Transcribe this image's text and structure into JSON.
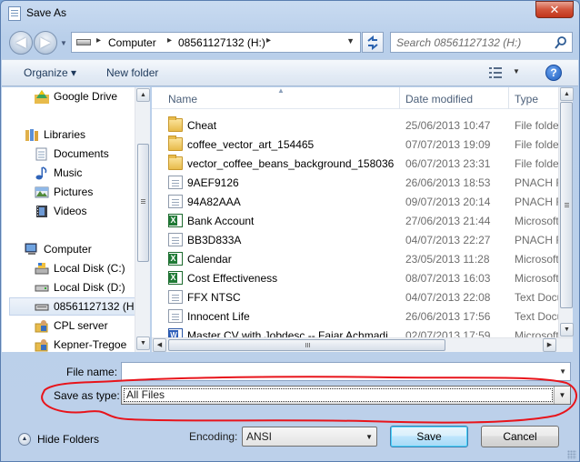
{
  "window": {
    "title": "Save As",
    "close_label": "✕"
  },
  "navigation": {
    "back_glyph": "◀",
    "forward_glyph": "▶",
    "breadcrumbs": [
      "Computer",
      "08561127132 (H:)"
    ],
    "search_placeholder": "Search 08561127132 (H:)"
  },
  "toolbar": {
    "organize_label": "Organize ▾",
    "new_folder_label": "New folder",
    "help_label": "?"
  },
  "nav_pane": {
    "items": [
      {
        "label": "Google Drive",
        "icon": "google-drive-icon"
      },
      {
        "label": "Libraries",
        "icon": "libraries-icon"
      },
      {
        "label": "Documents",
        "icon": "documents-icon"
      },
      {
        "label": "Music",
        "icon": "music-icon"
      },
      {
        "label": "Pictures",
        "icon": "pictures-icon"
      },
      {
        "label": "Videos",
        "icon": "videos-icon"
      },
      {
        "label": "Computer",
        "icon": "computer-icon"
      },
      {
        "label": "Local Disk (C:)",
        "icon": "local-disk-icon"
      },
      {
        "label": "Local Disk (D:)",
        "icon": "removable-disk-icon"
      },
      {
        "label": "08561127132 (H:)",
        "icon": "usb-drive-icon"
      },
      {
        "label": "CPL server",
        "icon": "network-user-icon"
      },
      {
        "label": "Kepner-Tregoe",
        "icon": "network-user-icon"
      }
    ]
  },
  "file_list": {
    "columns": [
      "Name",
      "Date modified",
      "Type"
    ],
    "rows": [
      {
        "name": "Cheat",
        "date": "25/06/2013 10:47",
        "type": "File folder",
        "icon": "folder-icon"
      },
      {
        "name": "coffee_vector_art_154465",
        "date": "07/07/2013 19:09",
        "type": "File folder",
        "icon": "folder-icon"
      },
      {
        "name": "vector_coffee_beans_background_158036",
        "date": "06/07/2013 23:31",
        "type": "File folder",
        "icon": "folder-icon"
      },
      {
        "name": "9AEF9126",
        "date": "26/06/2013 18:53",
        "type": "PNACH File",
        "icon": "document-icon"
      },
      {
        "name": "94A82AAA",
        "date": "09/07/2013 20:14",
        "type": "PNACH File",
        "icon": "document-icon"
      },
      {
        "name": "Bank Account",
        "date": "27/06/2013 21:44",
        "type": "Microsoft",
        "icon": "excel-icon"
      },
      {
        "name": "BB3D833A",
        "date": "04/07/2013 22:27",
        "type": "PNACH File",
        "icon": "document-icon"
      },
      {
        "name": "Calendar",
        "date": "23/05/2013 11:28",
        "type": "Microsoft",
        "icon": "excel-icon"
      },
      {
        "name": "Cost Effectiveness",
        "date": "08/07/2013 16:03",
        "type": "Microsoft",
        "icon": "excel-icon"
      },
      {
        "name": "FFX NTSC",
        "date": "04/07/2013 22:08",
        "type": "Text Document",
        "icon": "document-icon"
      },
      {
        "name": "Innocent Life",
        "date": "26/06/2013 17:56",
        "type": "Text Document",
        "icon": "document-icon"
      },
      {
        "name": "Master CV with Jobdesc -- Fajar Achmadi",
        "date": "02/07/2013 17:59",
        "type": "Microsoft",
        "icon": "word-icon"
      }
    ]
  },
  "form": {
    "file_name_label": "File name:",
    "file_name_value": "",
    "save_as_type_label": "Save as type:",
    "save_as_type_value": "All Files",
    "encoding_label": "Encoding:",
    "encoding_value": "ANSI"
  },
  "footer": {
    "hide_folders_label": "Hide Folders",
    "save_label": "Save",
    "cancel_label": "Cancel"
  },
  "annotation": {
    "ellipse_color": "#e8141b"
  }
}
